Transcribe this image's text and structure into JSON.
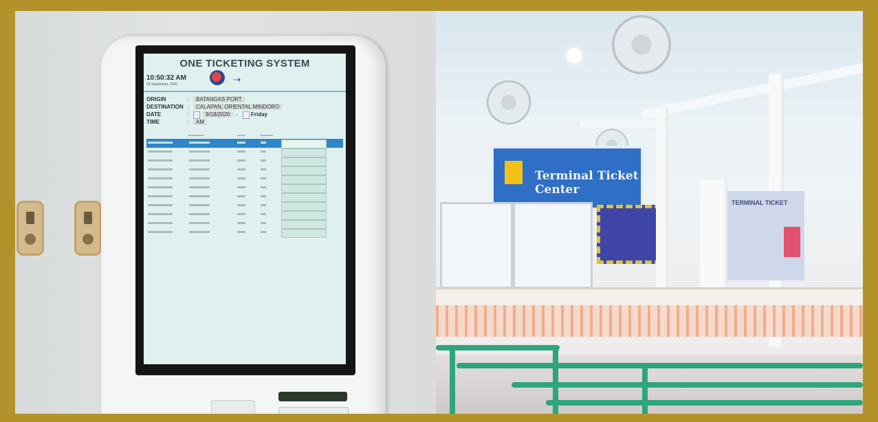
{
  "kiosk": {
    "title": "ONE TICKETING SYSTEM",
    "time": "10:50:32 AM",
    "date_small": "18 September, 2020",
    "form": {
      "origin_label": "ORIGIN",
      "origin_value": "BATANGAS PORT",
      "destination_label": "DESTINATION",
      "destination_value": "CALAPAN, ORIENTAL MINDORO",
      "date_label": "DATE",
      "date_value": "9/18/2020",
      "date_day": "Friday",
      "time_label": "TIME",
      "time_value": "AM"
    }
  },
  "scene": {
    "sign_text": "Terminal Ticket Center",
    "poster_title": "TERMINAL TICKET"
  }
}
